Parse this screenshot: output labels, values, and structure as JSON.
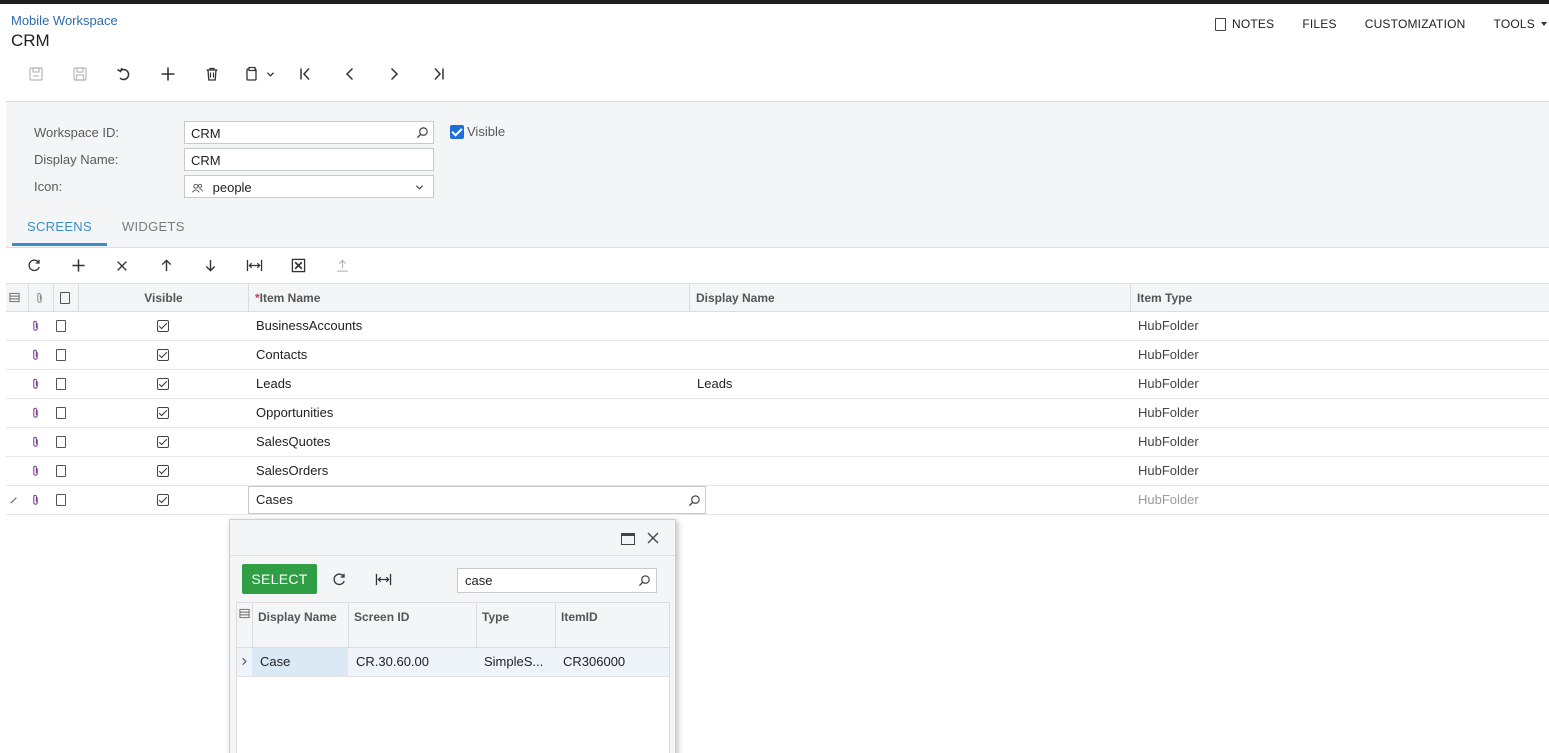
{
  "header": {
    "breadcrumb": "Mobile Workspace",
    "title": "CRM",
    "actions": {
      "notes": "NOTES",
      "files": "FILES",
      "customization": "CUSTOMIZATION",
      "tools": "TOOLS"
    }
  },
  "toolbar": {
    "icons": [
      "save-close-icon",
      "save-icon",
      "undo-icon",
      "add-icon",
      "delete-icon",
      "copy-paste-icon",
      "first-record-icon",
      "previous-record-icon",
      "next-record-icon",
      "last-record-icon"
    ]
  },
  "form": {
    "workspace_id_label": "Workspace ID:",
    "workspace_id_value": "CRM",
    "display_name_label": "Display Name:",
    "display_name_value": "CRM",
    "icon_label": "Icon:",
    "icon_value": "people",
    "visible_label": "Visible",
    "visible_checked": true
  },
  "tabs": [
    {
      "label": "SCREENS",
      "active": true
    },
    {
      "label": "WIDGETS",
      "active": false
    }
  ],
  "grid": {
    "columns": {
      "visible": "Visible",
      "required_mark": "*",
      "item_name": "Item Name",
      "display_name": "Display Name",
      "item_type": "Item Type"
    },
    "rows": [
      {
        "visible": true,
        "item_name": "BusinessAccounts",
        "display_name": "",
        "item_type": "HubFolder"
      },
      {
        "visible": true,
        "item_name": "Contacts",
        "display_name": "",
        "item_type": "HubFolder"
      },
      {
        "visible": true,
        "item_name": "Leads",
        "display_name": "Leads",
        "item_type": "HubFolder"
      },
      {
        "visible": true,
        "item_name": "Opportunities",
        "display_name": "",
        "item_type": "HubFolder"
      },
      {
        "visible": true,
        "item_name": "SalesQuotes",
        "display_name": "",
        "item_type": "HubFolder"
      },
      {
        "visible": true,
        "item_name": "SalesOrders",
        "display_name": "",
        "item_type": "HubFolder"
      },
      {
        "visible": true,
        "item_name": "Cases",
        "display_name": "",
        "item_type": "HubFolder",
        "editing": true
      }
    ]
  },
  "lookup_popup": {
    "select_label": "SELECT",
    "search_value": "case",
    "columns": {
      "display_name": "Display Name",
      "screen_id": "Screen ID",
      "type": "Type",
      "item_id": "ItemID"
    },
    "rows": [
      {
        "display_name": "Case",
        "screen_id": "CR.30.60.00",
        "type": "SimpleS...",
        "item_id": "CR306000"
      }
    ]
  },
  "colors": {
    "accent": "#3a8fc8",
    "select_green": "#2f9e44",
    "link_blue": "#2d6ea8"
  }
}
